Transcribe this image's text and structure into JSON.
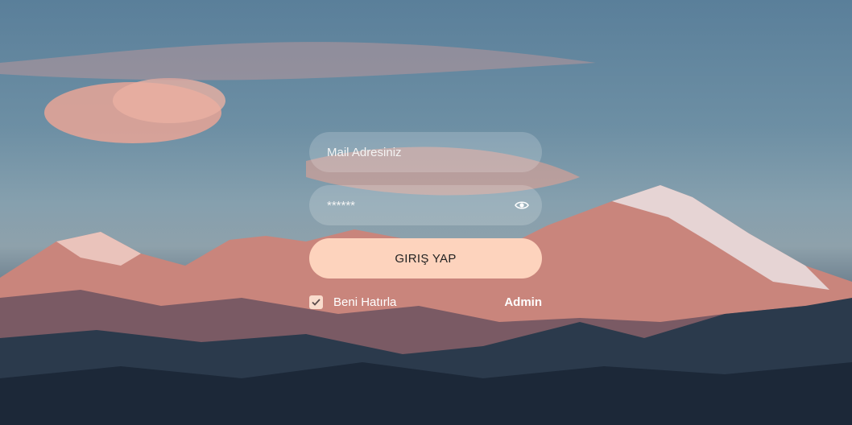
{
  "login": {
    "email_placeholder": "Mail Adresiniz",
    "password_value": "******",
    "submit_label": "GIRIŞ YAP",
    "remember_label": "Beni Hatırla",
    "remember_checked": true,
    "admin_link": "Admin"
  },
  "icons": {
    "password_toggle": "eye-icon",
    "remember_check": "checkmark-icon"
  },
  "colors": {
    "button_bg": "#fdd3bd",
    "checkbox_bg": "#f9dccd",
    "text": "#ffffff"
  }
}
